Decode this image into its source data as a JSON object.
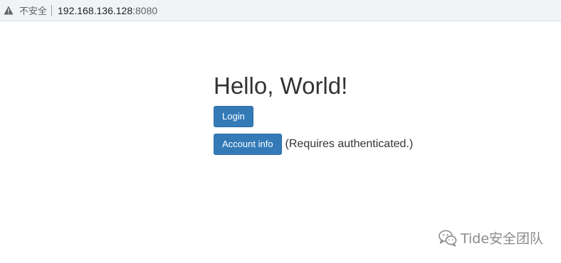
{
  "browser": {
    "security_label": "不安全",
    "url_host": "192.168.136.128",
    "url_port": ":8080",
    "warning_icon": "warning-triangle-icon"
  },
  "page": {
    "heading": "Hello, World!",
    "login_button": "Login",
    "account_button": "Account info",
    "account_note": "(Requires authenticated.)"
  },
  "watermark": {
    "text": "Tide安全团队",
    "icon": "wechat-icon"
  },
  "colors": {
    "button_primary": "#337ab7",
    "text": "#333333",
    "address_bar_bg": "#f1f3f4"
  }
}
